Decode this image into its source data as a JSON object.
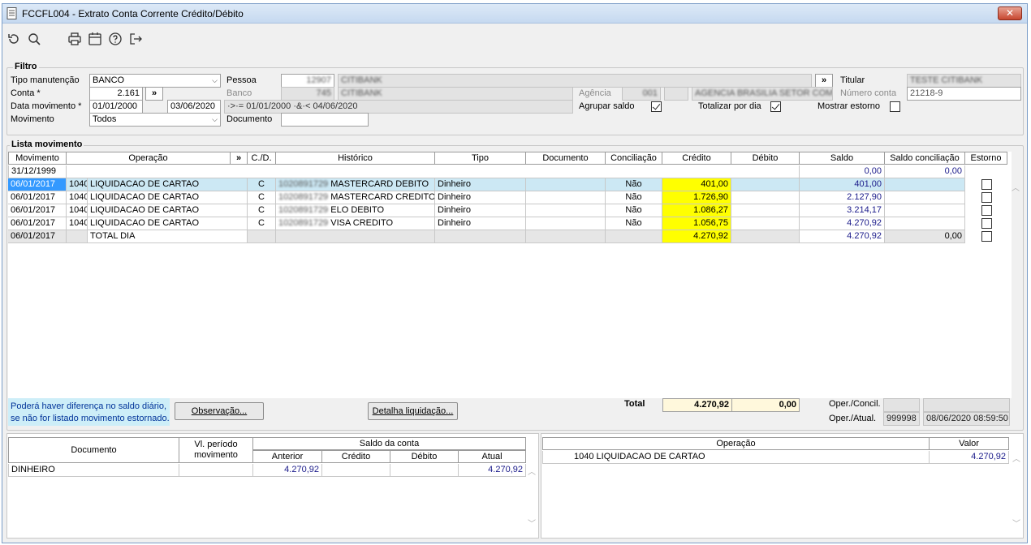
{
  "window": {
    "title": "FCCFL004 - Extrato Conta Corrente Crédito/Débito",
    "close": "✕"
  },
  "filter": {
    "legend": "Filtro",
    "tipo_manutencao_label": "Tipo manutenção",
    "tipo_manutencao_value": "BANCO",
    "conta_label": "Conta *",
    "conta_value": "2.161",
    "expand_symbol": "»",
    "data_movimento_label": "Data movimento *",
    "data_inicio": "01/01/2000",
    "data_fim": "03/06/2020",
    "data_expr": "·>·= 01/01/2000 ·&·< 04/06/2020",
    "movimento_label": "Movimento",
    "movimento_value": "Todos",
    "pessoa_label": "Pessoa",
    "pessoa_code": "12907",
    "pessoa_name": "CITIBANK",
    "banco_label": "Banco",
    "banco_code": "745",
    "banco_name": "CITIBANK",
    "agencia_label": "Agência",
    "agencia_code": "001",
    "agencia_name": "AGENCIA BRASILIA SETOR COMER",
    "documento_label": "Documento",
    "documento_value": "",
    "titular_label": "Titular",
    "titular_value": "TESTE CITIBANK",
    "numero_conta_label": "Número conta",
    "numero_conta_value": "21218-9",
    "agrupar_saldo_label": "Agrupar saldo",
    "agrupar_saldo_checked": true,
    "totalizar_dia_label": "Totalizar por dia",
    "totalizar_dia_checked": true,
    "mostrar_estorno_label": "Mostrar estorno",
    "mostrar_estorno_checked": false
  },
  "lista": {
    "legend": "Lista movimento",
    "headers": {
      "movimento": "Movimento",
      "operacao": "Operação",
      "expand": "»",
      "cd": "C./D.",
      "historico": "Histórico",
      "tipo": "Tipo",
      "documento": "Documento",
      "conciliacao": "Conciliação",
      "credito": "Crédito",
      "debito": "Débito",
      "saldo": "Saldo",
      "saldo_conciliacao": "Saldo conciliação",
      "estorno": "Estorno"
    },
    "opening": {
      "movimento": "31/12/1999",
      "saldo": "0,00",
      "saldo_conciliacao": "0,00"
    },
    "rows": [
      {
        "movimento": "06/01/2017",
        "op_code": "1040",
        "operacao": "LIQUIDACAO DE CARTAO",
        "cd": "C",
        "hist_code": "1020891729",
        "historico": "MASTERCARD DEBITO",
        "tipo": "Dinheiro",
        "documento": "",
        "conciliacao": "Não",
        "credito": "401,00",
        "debito": "",
        "saldo": "401,00",
        "saldo_conciliacao": ""
      },
      {
        "movimento": "06/01/2017",
        "op_code": "1040",
        "operacao": "LIQUIDACAO DE CARTAO",
        "cd": "C",
        "hist_code": "1020891729",
        "historico": "MASTERCARD CREDITO",
        "tipo": "Dinheiro",
        "documento": "",
        "conciliacao": "Não",
        "credito": "1.726,90",
        "debito": "",
        "saldo": "2.127,90",
        "saldo_conciliacao": ""
      },
      {
        "movimento": "06/01/2017",
        "op_code": "1040",
        "operacao": "LIQUIDACAO DE CARTAO",
        "cd": "C",
        "hist_code": "1020891729",
        "historico": "ELO DEBITO",
        "tipo": "Dinheiro",
        "documento": "",
        "conciliacao": "Não",
        "credito": "1.086,27",
        "debito": "",
        "saldo": "3.214,17",
        "saldo_conciliacao": ""
      },
      {
        "movimento": "06/01/2017",
        "op_code": "1040",
        "operacao": "LIQUIDACAO DE CARTAO",
        "cd": "C",
        "hist_code": "1020891729",
        "historico": "VISA CREDITO",
        "tipo": "Dinheiro",
        "documento": "",
        "conciliacao": "Não",
        "credito": "1.056,75",
        "debito": "",
        "saldo": "4.270,92",
        "saldo_conciliacao": ""
      }
    ],
    "total_row": {
      "movimento": "06/01/2017",
      "operacao": "TOTAL DIA",
      "credito": "4.270,92",
      "saldo": "4.270,92",
      "saldo_conciliacao": "0,00"
    }
  },
  "footer": {
    "note_line1": "Poderá haver diferença no saldo diário,",
    "note_line2": "se não for listado movimento estornado.",
    "observacao_button": "Observação...",
    "detalha_button": "Detalha liquidação...",
    "total_label": "Total",
    "total_credito": "4.270,92",
    "total_debito": "0,00",
    "oper_concil_label": "Oper./Concil.",
    "oper_atual_label": "Oper./Atual.",
    "oper_atual_user": "999998",
    "oper_atual_datetime": "08/06/2020 08:59:50"
  },
  "bottom_left": {
    "headers": {
      "documento": "Documento",
      "vl_periodo": "Vl. período",
      "vl_periodo2": "movimento",
      "saldo_conta": "Saldo da conta",
      "anterior": "Anterior",
      "credito": "Crédito",
      "debito": "Débito",
      "atual": "Atual"
    },
    "row": {
      "documento": "DINHEIRO",
      "vl_periodo": "",
      "anterior": "4.270,92",
      "credito": "",
      "debito": "",
      "atual": "4.270,92"
    }
  },
  "bottom_right": {
    "headers": {
      "operacao": "Operação",
      "valor": "Valor"
    },
    "row": {
      "op_code": "1040",
      "operacao": "LIQUIDACAO DE CARTAO",
      "valor": "4.270,92"
    }
  }
}
